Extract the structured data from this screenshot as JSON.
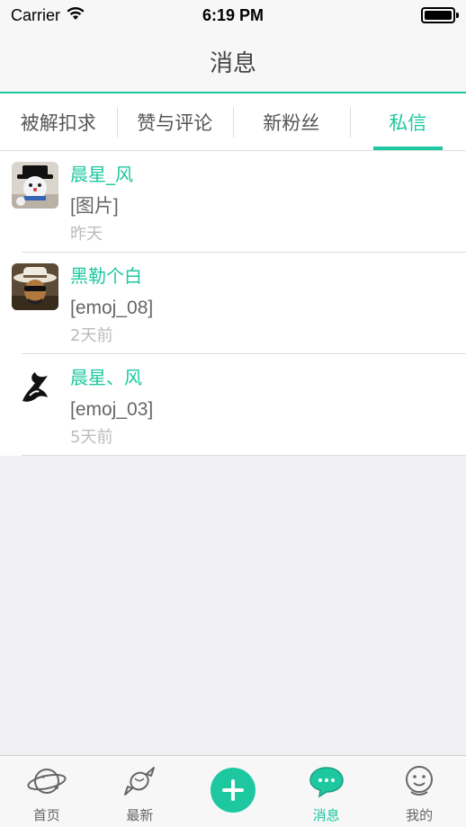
{
  "status_bar": {
    "carrier": "Carrier",
    "time": "6:19 PM",
    "icons": [
      "wifi-icon",
      "battery-icon"
    ]
  },
  "nav": {
    "title": "消息"
  },
  "tabs": [
    {
      "label": "被解扣求",
      "active": false
    },
    {
      "label": "赞与评论",
      "active": false
    },
    {
      "label": "新粉丝",
      "active": false
    },
    {
      "label": "私信",
      "active": true
    }
  ],
  "messages": [
    {
      "name": "晨星_风",
      "text": "[图片]",
      "time": "昨天",
      "avatar": "snowman-avatar"
    },
    {
      "name": "黑勒个白",
      "text": "[emoj_08]",
      "time": "2天前",
      "avatar": "hat-man-avatar"
    },
    {
      "name": "晨星、风",
      "text": "[emoj_03]",
      "time": "5天前",
      "avatar": "fairy-tail-avatar"
    }
  ],
  "tabbar": {
    "items": [
      {
        "label": "首页",
        "icon": "planet-icon",
        "active": false
      },
      {
        "label": "最新",
        "icon": "candy-icon",
        "active": false
      },
      {
        "label": "",
        "icon": "plus-icon",
        "active": false
      },
      {
        "label": "消息",
        "icon": "chat-bubble-icon",
        "active": true
      },
      {
        "label": "我的",
        "icon": "face-icon",
        "active": false
      }
    ]
  },
  "colors": {
    "accent": "#1dc8a0",
    "background": "#efeff4"
  }
}
